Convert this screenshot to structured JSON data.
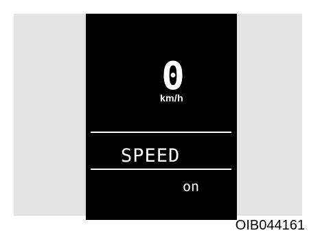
{
  "cluster_display": {
    "speed_value": "0",
    "speed_unit": "km/h",
    "mode_label": "SPEED",
    "mode_state": "on"
  },
  "figure": {
    "code": "OIB044161"
  },
  "colors": {
    "background": "#e3e3e3",
    "display": "#000000",
    "display_text": "#ffffff"
  }
}
